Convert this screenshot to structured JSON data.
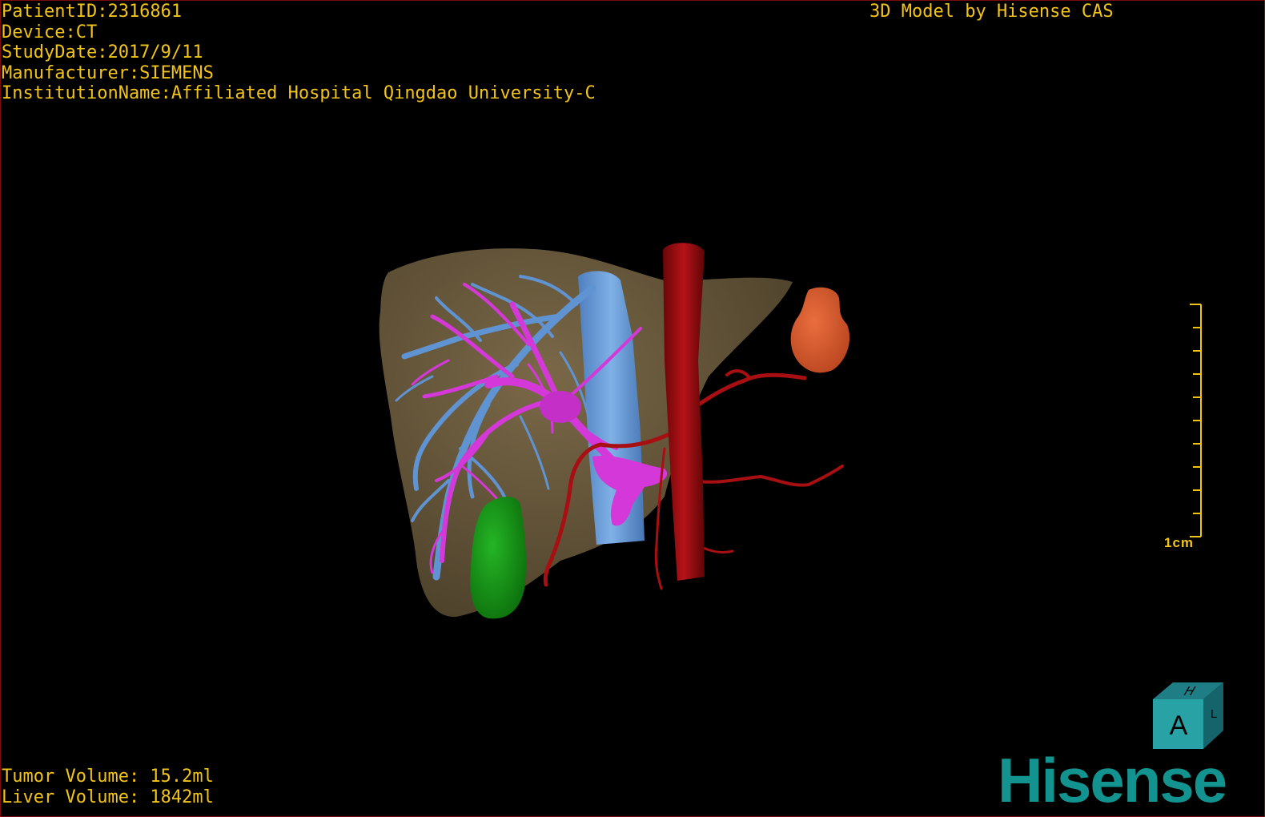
{
  "study_info": {
    "patient_id": "PatientID:2316861",
    "device": "Device:CT",
    "study_date": "StudyDate:2017/9/11",
    "manufacturer": "Manufacturer:SIEMENS",
    "institution": "InstitutionName:Affiliated Hospital Qingdao University-C"
  },
  "credit": "3D Model by Hisense CAS",
  "volumes": {
    "tumor": "Tumor Volume: 15.2ml",
    "liver": "Liver Volume: 1842ml"
  },
  "scale_bar": {
    "label": "1cm"
  },
  "orientation_cube": {
    "front": "A",
    "top": "H",
    "right": "L"
  },
  "brand": "Hisense",
  "colors": {
    "overlay_text": "#f2c418",
    "liver": "#6a5a3c",
    "portal_vein": "#d438d8",
    "hepatic_vein": "#5f93d2",
    "artery": "#a70f12",
    "tumor": "#169a16",
    "kidney_organ": "#d8582c",
    "brand": "#13938f"
  },
  "icons": [
    "orientation-cube-icon",
    "scale-bar-icon"
  ]
}
